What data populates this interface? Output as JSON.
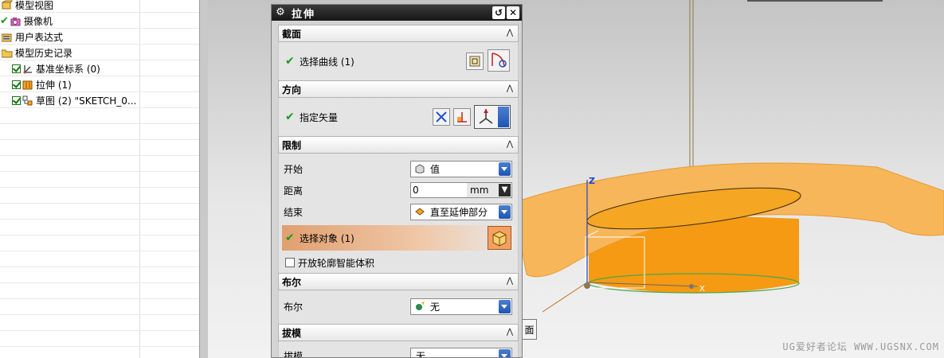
{
  "navigator": {
    "items": [
      {
        "label": "模型视图",
        "icon": "view-icon"
      },
      {
        "label": "摄像机",
        "icon": "camera-icon"
      },
      {
        "label": "用户表达式",
        "icon": "expression-icon"
      },
      {
        "label": "模型历史记录",
        "icon": "folder-icon"
      },
      {
        "label": "基准坐标系 (0)",
        "icon": "csys-icon"
      },
      {
        "label": "拉伸 (1)",
        "icon": "extrude-icon"
      },
      {
        "label": "草图 (2) \"SKETCH_0...",
        "icon": "sketch-icon"
      }
    ]
  },
  "dialog": {
    "title": "拉伸",
    "sections": {
      "section": {
        "header": "截面",
        "select_curve": "选择曲线 (1)"
      },
      "direction": {
        "header": "方向",
        "specify_vector": "指定矢量"
      },
      "limits": {
        "header": "限制",
        "start_label": "开始",
        "start_value": "值",
        "distance_label": "距离",
        "distance_value": "0",
        "distance_unit": "mm",
        "end_label": "结束",
        "end_value": "直至延伸部分",
        "select_object": "选择对象 (1)",
        "open_profile": "开放轮廓智能体积"
      },
      "boolean": {
        "header": "布尔",
        "label": "布尔",
        "value": "无"
      },
      "draft": {
        "header": "拔模",
        "label": "拔模",
        "value": "无"
      }
    }
  },
  "graphics": {
    "face_tooltip": "面",
    "watermark": "UG爱好者论坛 WWW.UGSNX.COM",
    "axis_labels": {
      "z": "Z",
      "x": "X"
    }
  },
  "colors": {
    "body_orange": "#f5a623",
    "face_light": "#f7b659",
    "accent_blue": "#1e55b3",
    "check_green": "#1a9a1a"
  }
}
